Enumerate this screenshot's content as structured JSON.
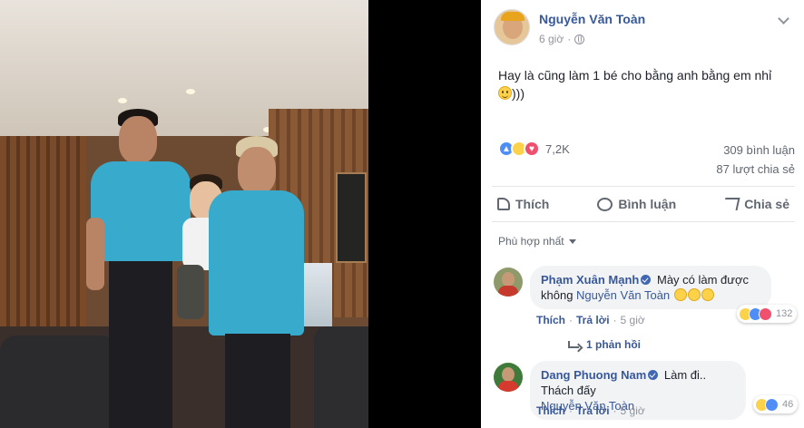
{
  "post": {
    "author": "Nguyễn Văn Toàn",
    "time": "6 giờ",
    "text": "Hay là cũng làm 1 bé cho bằng anh bằng em nhỉ",
    "text_suffix": ")))",
    "reaction_count": "7,2K",
    "comment_count": "309 bình luận",
    "share_count": "87 lượt chia sẻ",
    "reactions": [
      "like-reaction-icon",
      "haha-reaction-icon",
      "love-reaction-icon"
    ]
  },
  "actions": {
    "like_label": "Thích",
    "comment_label": "Bình luận",
    "share_label": "Chia sẻ"
  },
  "sort": {
    "label": "Phù hợp nhất"
  },
  "comments": [
    {
      "name": "Phạm Xuân Mạnh",
      "text": "Mày có làm được không",
      "mention": "Nguyễn Văn Toàn",
      "reaction_count": "132",
      "like_label": "Thích",
      "reply_label": "Trả lời",
      "time": "5 giờ",
      "replies_label": "1 phản hồi"
    },
    {
      "name": "Dang Phuong Nam",
      "text": "Làm đi.. Thách đấy",
      "mention": "Nguyễn Văn Toàn",
      "reaction_count": "46",
      "like_label": "Thích",
      "reply_label": "Trả lời",
      "time": "5 giờ"
    }
  ],
  "colors": {
    "link": "#385898",
    "shirt": "#38aacc",
    "meta": "#90949c"
  }
}
